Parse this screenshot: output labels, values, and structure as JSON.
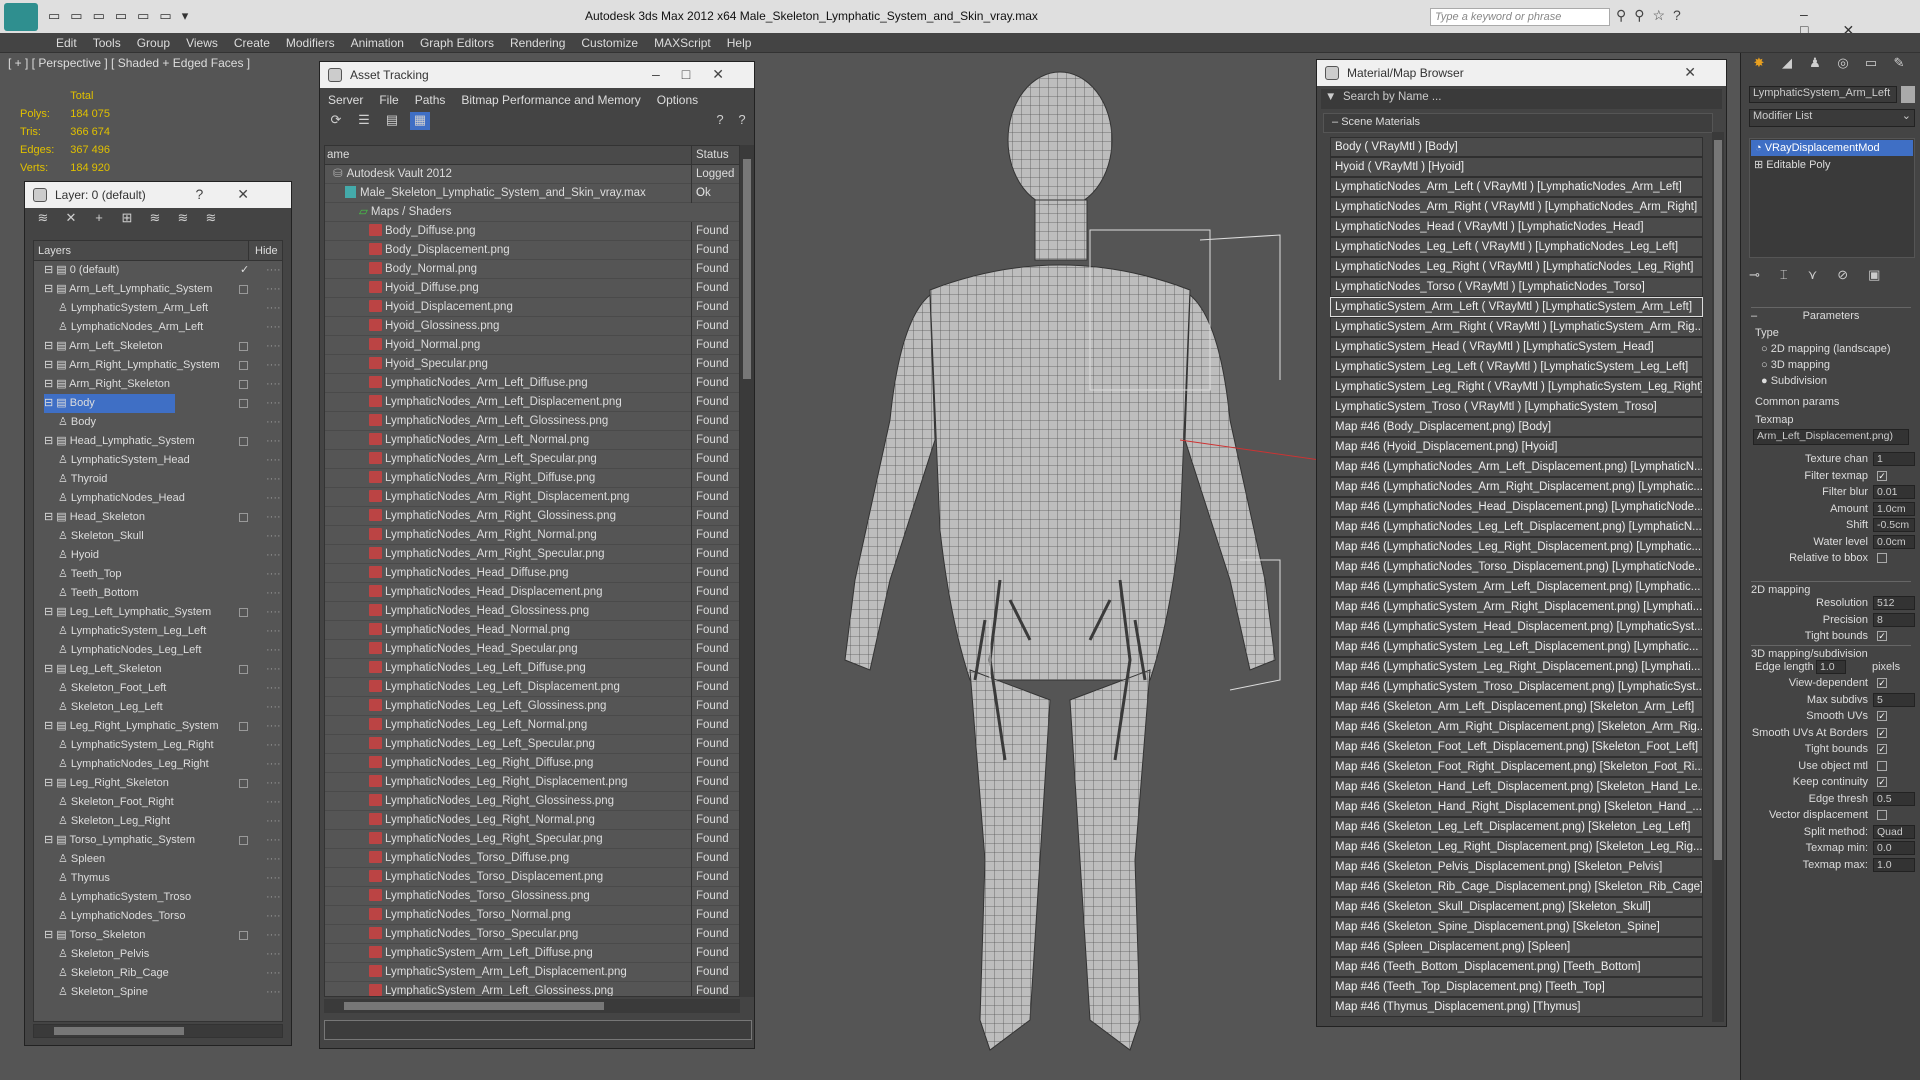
{
  "app": {
    "title": "Autodesk 3ds Max  2012 x64    Male_Skeleton_Lymphatic_System_and_Skin_vray.max",
    "search_placeholder": "Type a keyword or phrase"
  },
  "menu": [
    "Edit",
    "Tools",
    "Group",
    "Views",
    "Create",
    "Modifiers",
    "Animation",
    "Graph Editors",
    "Rendering",
    "Customize",
    "MAXScript",
    "Help"
  ],
  "viewport": {
    "label": "[ + ] [ Perspective ] [ Shaded + Edged Faces ]",
    "stats": {
      "header": "Total",
      "rows": [
        [
          "Polys:",
          "184 075"
        ],
        [
          "Tris:",
          "366 674"
        ],
        [
          "Edges:",
          "367 496"
        ],
        [
          "Verts:",
          "184 920"
        ]
      ]
    }
  },
  "layer_panel": {
    "title": "Layer: 0 (default)",
    "col_layers": "Layers",
    "col_hide": "Hide",
    "rows": [
      {
        "name": "0 (default)",
        "level": 1,
        "check": "✓",
        "box": false
      },
      {
        "name": "Arm_Left_Lymphatic_System",
        "level": 1,
        "box": true
      },
      {
        "name": "LymphaticSystem_Arm_Left",
        "level": 2,
        "box": false
      },
      {
        "name": "LymphaticNodes_Arm_Left",
        "level": 2,
        "box": false
      },
      {
        "name": "Arm_Left_Skeleton",
        "level": 1,
        "box": true
      },
      {
        "name": "Arm_Right_Lymphatic_System",
        "level": 1,
        "box": true
      },
      {
        "name": "Arm_Right_Skeleton",
        "level": 1,
        "box": true
      },
      {
        "name": "Body",
        "level": 1,
        "box": true,
        "selected": true
      },
      {
        "name": "Body",
        "level": 2,
        "box": false
      },
      {
        "name": "Head_Lymphatic_System",
        "level": 1,
        "box": true
      },
      {
        "name": "LymphaticSystem_Head",
        "level": 2,
        "box": false
      },
      {
        "name": "Thyroid",
        "level": 2,
        "box": false
      },
      {
        "name": "LymphaticNodes_Head",
        "level": 2,
        "box": false
      },
      {
        "name": "Head_Skeleton",
        "level": 1,
        "box": true
      },
      {
        "name": "Skeleton_Skull",
        "level": 2,
        "box": false
      },
      {
        "name": "Hyoid",
        "level": 2,
        "box": false
      },
      {
        "name": "Teeth_Top",
        "level": 2,
        "box": false
      },
      {
        "name": "Teeth_Bottom",
        "level": 2,
        "box": false
      },
      {
        "name": "Leg_Left_Lymphatic_System",
        "level": 1,
        "box": true
      },
      {
        "name": "LymphaticSystem_Leg_Left",
        "level": 2,
        "box": false
      },
      {
        "name": "LymphaticNodes_Leg_Left",
        "level": 2,
        "box": false
      },
      {
        "name": "Leg_Left_Skeleton",
        "level": 1,
        "box": true
      },
      {
        "name": "Skeleton_Foot_Left",
        "level": 2,
        "box": false
      },
      {
        "name": "Skeleton_Leg_Left",
        "level": 2,
        "box": false
      },
      {
        "name": "Leg_Right_Lymphatic_System",
        "level": 1,
        "box": true
      },
      {
        "name": "LymphaticSystem_Leg_Right",
        "level": 2,
        "box": false
      },
      {
        "name": "LymphaticNodes_Leg_Right",
        "level": 2,
        "box": false
      },
      {
        "name": "Leg_Right_Skeleton",
        "level": 1,
        "box": true
      },
      {
        "name": "Skeleton_Foot_Right",
        "level": 2,
        "box": false
      },
      {
        "name": "Skeleton_Leg_Right",
        "level": 2,
        "box": false
      },
      {
        "name": "Torso_Lymphatic_System",
        "level": 1,
        "box": true
      },
      {
        "name": "Spleen",
        "level": 2,
        "box": false
      },
      {
        "name": "Thymus",
        "level": 2,
        "box": false
      },
      {
        "name": "LymphaticSystem_Troso",
        "level": 2,
        "box": false
      },
      {
        "name": "LymphaticNodes_Torso",
        "level": 2,
        "box": false
      },
      {
        "name": "Torso_Skeleton",
        "level": 1,
        "box": true
      },
      {
        "name": "Skeleton_Pelvis",
        "level": 2,
        "box": false
      },
      {
        "name": "Skeleton_Rib_Cage",
        "level": 2,
        "box": false
      },
      {
        "name": "Skeleton_Spine",
        "level": 2,
        "box": false
      }
    ]
  },
  "asset_tracking": {
    "title": "Asset Tracking",
    "menu": [
      "Server",
      "File",
      "Paths",
      "Bitmap Performance and Memory",
      "Options"
    ],
    "col_name": "ame",
    "col_status": "Status",
    "rows": [
      {
        "name": "Autodesk Vault 2012",
        "status": "Logged O",
        "level": 0,
        "icon": "vault"
      },
      {
        "name": "Male_Skeleton_Lymphatic_System_and_Skin_vray.max",
        "status": "Ok",
        "level": 1,
        "icon": "max"
      },
      {
        "name": "Maps / Shaders",
        "status": "",
        "level": 2,
        "icon": "folder"
      },
      {
        "name": "Body_Diffuse.png",
        "status": "Found",
        "level": 3,
        "icon": "png"
      },
      {
        "name": "Body_Displacement.png",
        "status": "Found",
        "level": 3,
        "icon": "png"
      },
      {
        "name": "Body_Normal.png",
        "status": "Found",
        "level": 3,
        "icon": "png"
      },
      {
        "name": "Hyoid_Diffuse.png",
        "status": "Found",
        "level": 3,
        "icon": "png"
      },
      {
        "name": "Hyoid_Displacement.png",
        "status": "Found",
        "level": 3,
        "icon": "png"
      },
      {
        "name": "Hyoid_Glossiness.png",
        "status": "Found",
        "level": 3,
        "icon": "png"
      },
      {
        "name": "Hyoid_Normal.png",
        "status": "Found",
        "level": 3,
        "icon": "png"
      },
      {
        "name": "Hyoid_Specular.png",
        "status": "Found",
        "level": 3,
        "icon": "png"
      },
      {
        "name": "LymphaticNodes_Arm_Left_Diffuse.png",
        "status": "Found",
        "level": 3,
        "icon": "png"
      },
      {
        "name": "LymphaticNodes_Arm_Left_Displacement.png",
        "status": "Found",
        "level": 3,
        "icon": "png"
      },
      {
        "name": "LymphaticNodes_Arm_Left_Glossiness.png",
        "status": "Found",
        "level": 3,
        "icon": "png"
      },
      {
        "name": "LymphaticNodes_Arm_Left_Normal.png",
        "status": "Found",
        "level": 3,
        "icon": "png"
      },
      {
        "name": "LymphaticNodes_Arm_Left_Specular.png",
        "status": "Found",
        "level": 3,
        "icon": "png"
      },
      {
        "name": "LymphaticNodes_Arm_Right_Diffuse.png",
        "status": "Found",
        "level": 3,
        "icon": "png"
      },
      {
        "name": "LymphaticNodes_Arm_Right_Displacement.png",
        "status": "Found",
        "level": 3,
        "icon": "png"
      },
      {
        "name": "LymphaticNodes_Arm_Right_Glossiness.png",
        "status": "Found",
        "level": 3,
        "icon": "png"
      },
      {
        "name": "LymphaticNodes_Arm_Right_Normal.png",
        "status": "Found",
        "level": 3,
        "icon": "png"
      },
      {
        "name": "LymphaticNodes_Arm_Right_Specular.png",
        "status": "Found",
        "level": 3,
        "icon": "png"
      },
      {
        "name": "LymphaticNodes_Head_Diffuse.png",
        "status": "Found",
        "level": 3,
        "icon": "png"
      },
      {
        "name": "LymphaticNodes_Head_Displacement.png",
        "status": "Found",
        "level": 3,
        "icon": "png"
      },
      {
        "name": "LymphaticNodes_Head_Glossiness.png",
        "status": "Found",
        "level": 3,
        "icon": "png"
      },
      {
        "name": "LymphaticNodes_Head_Normal.png",
        "status": "Found",
        "level": 3,
        "icon": "png"
      },
      {
        "name": "LymphaticNodes_Head_Specular.png",
        "status": "Found",
        "level": 3,
        "icon": "png"
      },
      {
        "name": "LymphaticNodes_Leg_Left_Diffuse.png",
        "status": "Found",
        "level": 3,
        "icon": "png"
      },
      {
        "name": "LymphaticNodes_Leg_Left_Displacement.png",
        "status": "Found",
        "level": 3,
        "icon": "png"
      },
      {
        "name": "LymphaticNodes_Leg_Left_Glossiness.png",
        "status": "Found",
        "level": 3,
        "icon": "png"
      },
      {
        "name": "LymphaticNodes_Leg_Left_Normal.png",
        "status": "Found",
        "level": 3,
        "icon": "png"
      },
      {
        "name": "LymphaticNodes_Leg_Left_Specular.png",
        "status": "Found",
        "level": 3,
        "icon": "png"
      },
      {
        "name": "LymphaticNodes_Leg_Right_Diffuse.png",
        "status": "Found",
        "level": 3,
        "icon": "png"
      },
      {
        "name": "LymphaticNodes_Leg_Right_Displacement.png",
        "status": "Found",
        "level": 3,
        "icon": "png"
      },
      {
        "name": "LymphaticNodes_Leg_Right_Glossiness.png",
        "status": "Found",
        "level": 3,
        "icon": "png"
      },
      {
        "name": "LymphaticNodes_Leg_Right_Normal.png",
        "status": "Found",
        "level": 3,
        "icon": "png"
      },
      {
        "name": "LymphaticNodes_Leg_Right_Specular.png",
        "status": "Found",
        "level": 3,
        "icon": "png"
      },
      {
        "name": "LymphaticNodes_Torso_Diffuse.png",
        "status": "Found",
        "level": 3,
        "icon": "png"
      },
      {
        "name": "LymphaticNodes_Torso_Displacement.png",
        "status": "Found",
        "level": 3,
        "icon": "png"
      },
      {
        "name": "LymphaticNodes_Torso_Glossiness.png",
        "status": "Found",
        "level": 3,
        "icon": "png"
      },
      {
        "name": "LymphaticNodes_Torso_Normal.png",
        "status": "Found",
        "level": 3,
        "icon": "png"
      },
      {
        "name": "LymphaticNodes_Torso_Specular.png",
        "status": "Found",
        "level": 3,
        "icon": "png"
      },
      {
        "name": "LymphaticSystem_Arm_Left_Diffuse.png",
        "status": "Found",
        "level": 3,
        "icon": "png"
      },
      {
        "name": "LymphaticSystem_Arm_Left_Displacement.png",
        "status": "Found",
        "level": 3,
        "icon": "png"
      },
      {
        "name": "LymphaticSystem_Arm_Left_Glossiness.png",
        "status": "Found",
        "level": 3,
        "icon": "png"
      }
    ]
  },
  "material_browser": {
    "title": "Material/Map Browser",
    "search_placeholder": "Search by Name ...",
    "section": "Scene Materials",
    "items": [
      "Body  ( VRayMtl ) [Body]",
      "Hyoid  ( VRayMtl ) [Hyoid]",
      "LymphaticNodes_Arm_Left  ( VRayMtl ) [LymphaticNodes_Arm_Left]",
      "LymphaticNodes_Arm_Right  ( VRayMtl ) [LymphaticNodes_Arm_Right]",
      "LymphaticNodes_Head  ( VRayMtl ) [LymphaticNodes_Head]",
      "LymphaticNodes_Leg_Left  ( VRayMtl ) [LymphaticNodes_Leg_Left]",
      "LymphaticNodes_Leg_Right  ( VRayMtl ) [LymphaticNodes_Leg_Right]",
      "LymphaticNodes_Torso  ( VRayMtl ) [LymphaticNodes_Torso]",
      "LymphaticSystem_Arm_Left  ( VRayMtl ) [LymphaticSystem_Arm_Left]",
      "LymphaticSystem_Arm_Right  ( VRayMtl ) [LymphaticSystem_Arm_Rig...",
      "LymphaticSystem_Head  ( VRayMtl ) [LymphaticSystem_Head]",
      "LymphaticSystem_Leg_Left  ( VRayMtl ) [LymphaticSystem_Leg_Left]",
      "LymphaticSystem_Leg_Right  ( VRayMtl ) [LymphaticSystem_Leg_Right]",
      "LymphaticSystem_Troso  ( VRayMtl ) [LymphaticSystem_Troso]",
      "Map #46 (Body_Displacement.png) [Body]",
      "Map #46 (Hyoid_Displacement.png) [Hyoid]",
      "Map #46 (LymphaticNodes_Arm_Left_Displacement.png) [LymphaticN...",
      "Map #46 (LymphaticNodes_Arm_Right_Displacement.png) [Lymphatic...",
      "Map #46 (LymphaticNodes_Head_Displacement.png) [LymphaticNode...",
      "Map #46 (LymphaticNodes_Leg_Left_Displacement.png) [LymphaticN...",
      "Map #46 (LymphaticNodes_Leg_Right_Displacement.png) [Lymphatic...",
      "Map #46 (LymphaticNodes_Torso_Displacement.png) [LymphaticNode...",
      "Map #46 (LymphaticSystem_Arm_Left_Displacement.png) [Lymphatic...",
      "Map #46 (LymphaticSystem_Arm_Right_Displacement.png) [Lymphati...",
      "Map #46 (LymphaticSystem_Head_Displacement.png) [LymphaticSyst...",
      "Map #46 (LymphaticSystem_Leg_Left_Displacement.png) [Lymphatic...",
      "Map #46 (LymphaticSystem_Leg_Right_Displacement.png) [Lymphati...",
      "Map #46 (LymphaticSystem_Troso_Displacement.png) [LymphaticSyst...",
      "Map #46 (Skeleton_Arm_Left_Displacement.png) [Skeleton_Arm_Left]",
      "Map #46 (Skeleton_Arm_Right_Displacement.png) [Skeleton_Arm_Rig...",
      "Map #46 (Skeleton_Foot_Left_Displacement.png) [Skeleton_Foot_Left]",
      "Map #46 (Skeleton_Foot_Right_Displacement.png) [Skeleton_Foot_Ri...",
      "Map #46 (Skeleton_Hand_Left_Displacement.png) [Skeleton_Hand_Le...",
      "Map #46 (Skeleton_Hand_Right_Displacement.png) [Skeleton_Hand_...",
      "Map #46 (Skeleton_Leg_Left_Displacement.png) [Skeleton_Leg_Left]",
      "Map #46 (Skeleton_Leg_Right_Displacement.png) [Skeleton_Leg_Rig...",
      "Map #46 (Skeleton_Pelvis_Displacement.png) [Skeleton_Pelvis]",
      "Map #46 (Skeleton_Rib_Cage_Displacement.png) [Skeleton_Rib_Cage]",
      "Map #46 (Skeleton_Skull_Displacement.png) [Skeleton_Skull]",
      "Map #46 (Skeleton_Spine_Displacement.png) [Skeleton_Spine]",
      "Map #46 (Spleen_Displacement.png) [Spleen]",
      "Map #46 (Teeth_Bottom_Displacement.png) [Teeth_Bottom]",
      "Map #46 (Teeth_Top_Displacement.png) [Teeth_Top]",
      "Map #46 (Thymus_Displacement.png) [Thymus]"
    ],
    "selected_index": 8
  },
  "command_panel": {
    "object_name": "LymphaticSystem_Arm_Left",
    "modifier_list": "Modifier List",
    "stack": [
      "VRayDisplacementMod",
      "Editable Poly"
    ],
    "parameters": "Parameters",
    "type_label": "Type",
    "type_options": [
      "2D mapping (landscape)",
      "3D mapping",
      "Subdivision"
    ],
    "common_params": "Common params",
    "texmap_label": "Texmap",
    "texmap_value": "Arm_Left_Displacement.png)",
    "fields": [
      {
        "label": "Texture chan",
        "value": "1"
      },
      {
        "label": "Filter texmap",
        "check": true
      },
      {
        "label": "Filter blur",
        "value": "0.01"
      },
      {
        "label": "Amount",
        "value": "1.0cm"
      },
      {
        "label": "Shift",
        "value": "-0.5cm"
      },
      {
        "label": "Water level",
        "value": "0.0cm"
      },
      {
        "label": "Relative to bbox",
        "check": false
      }
    ],
    "mapping2d": "2D mapping",
    "fields2d": [
      {
        "label": "Resolution",
        "value": "512"
      },
      {
        "label": "Precision",
        "value": "8"
      },
      {
        "label": "Tight bounds",
        "check": true
      }
    ],
    "mapping3d": "3D mapping/subdivision",
    "edge_length_label": "Edge length",
    "edge_length_value": "1.0",
    "pixels": "pixels",
    "fields3d": [
      {
        "label": "View-dependent",
        "check": true
      },
      {
        "label": "Max subdivs",
        "value": "5"
      },
      {
        "label": "Smooth UVs",
        "check": true
      },
      {
        "label": "Smooth UVs At Borders",
        "check": true
      },
      {
        "label": "Tight bounds",
        "check": true
      },
      {
        "label": "Use object mtl",
        "check": false
      },
      {
        "label": "Keep continuity",
        "check": true
      },
      {
        "label": "Edge thresh",
        "value": "0.5"
      },
      {
        "label": "Vector displacement",
        "check": false
      },
      {
        "label": "Split method:",
        "value": "Quad"
      },
      {
        "label": "Texmap min:",
        "value": "0.0"
      },
      {
        "label": "Texmap max:",
        "value": "1.0"
      }
    ]
  }
}
